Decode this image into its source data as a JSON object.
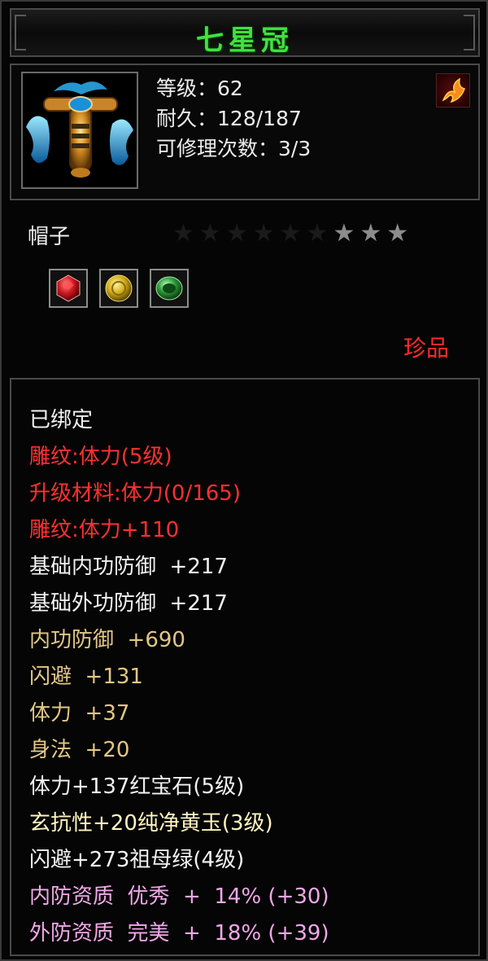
{
  "item": {
    "name": "七星冠",
    "level_label": "等级",
    "level_value": "62",
    "durability_label": "耐久",
    "durability_value": "128/187",
    "repair_label": "可修理次数",
    "repair_value": "3/3",
    "separator": "：",
    "type": "帽子",
    "rarity": "珍品",
    "stars": {
      "total": 9,
      "lit": 3
    },
    "icon": "helmet-crown-icon",
    "badge_icon": "flame-icon"
  },
  "gems": [
    {
      "name": "ruby-gem-icon",
      "color": "#c0141c"
    },
    {
      "name": "yellow-jade-gem-icon",
      "color": "#c9a81a"
    },
    {
      "name": "emerald-gem-icon",
      "color": "#2f9a3a"
    }
  ],
  "attributes": [
    {
      "text": "已绑定",
      "color": "white"
    },
    {
      "text": "雕纹:体力(5级)",
      "color": "red"
    },
    {
      "text": "升级材料:体力(0/165)",
      "color": "red"
    },
    {
      "text": "雕纹:体力+110",
      "color": "red"
    },
    {
      "text": "基础内功防御  +217",
      "color": "white"
    },
    {
      "text": "基础外功防御  +217",
      "color": "white"
    },
    {
      "text": "内功防御  +690",
      "color": "gold"
    },
    {
      "text": "闪避  +131",
      "color": "gold"
    },
    {
      "text": "体力  +37",
      "color": "gold"
    },
    {
      "text": "身法  +20",
      "color": "gold"
    },
    {
      "text": "体力+137红宝石(5级)",
      "color": "white"
    },
    {
      "text": "玄抗性+20纯净黄玉(3级)",
      "color": "cream"
    },
    {
      "text": "闪避+273祖母绿(4级)",
      "color": "white"
    },
    {
      "text": "内防资质  优秀  +  14% (+30)",
      "color": "pink"
    },
    {
      "text": "外防资质  完美  +  18% (+39)",
      "color": "pink"
    }
  ]
}
